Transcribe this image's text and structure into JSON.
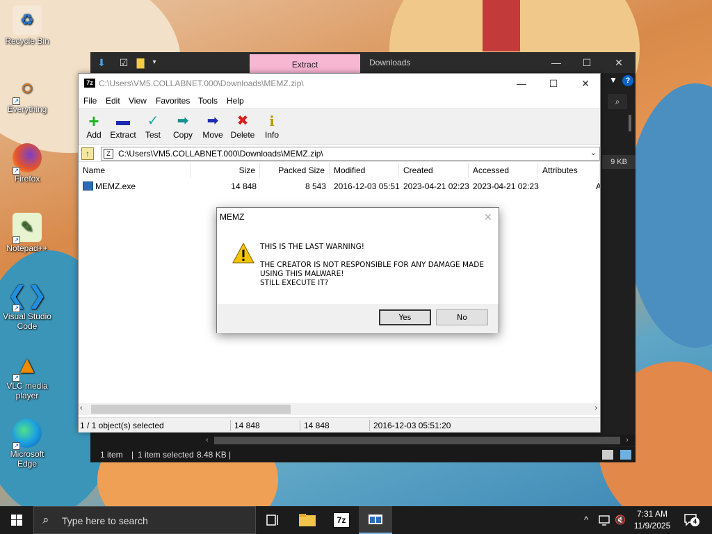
{
  "desktop": {
    "icons": [
      {
        "label": "Recycle Bin"
      },
      {
        "label": "Everything"
      },
      {
        "label": "Firefox"
      },
      {
        "label": "Notepad++"
      },
      {
        "label": "Visual Studio Code"
      },
      {
        "label": "VLC media player"
      },
      {
        "label": "Microsoft Edge"
      }
    ]
  },
  "explorer": {
    "tab_extract": "Extract",
    "tab_downloads": "Downloads",
    "size_chip": "9 KB",
    "status": {
      "items": "1 item",
      "selected": "1 item selected",
      "size": "8.48 KB",
      "sep": "|"
    }
  },
  "sevenzip": {
    "title": "C:\\Users\\VM5.COLLABNET.000\\Downloads\\MEMZ.zip\\",
    "menu": [
      "File",
      "Edit",
      "View",
      "Favorites",
      "Tools",
      "Help"
    ],
    "toolbar": [
      {
        "label": "Add",
        "icon": "+"
      },
      {
        "label": "Extract",
        "icon": "▬"
      },
      {
        "label": "Test",
        "icon": "✓"
      },
      {
        "label": "Copy",
        "icon": "➡"
      },
      {
        "label": "Move",
        "icon": "➡"
      },
      {
        "label": "Delete",
        "icon": "✖"
      },
      {
        "label": "Info",
        "icon": "i"
      }
    ],
    "address": "C:\\Users\\VM5.COLLABNET.000\\Downloads\\MEMZ.zip\\",
    "columns": [
      "Name",
      "Size",
      "Packed Size",
      "Modified",
      "Created",
      "Accessed",
      "Attributes"
    ],
    "rows": [
      {
        "name": "MEMZ.exe",
        "size": "14 848",
        "packed": "8 543",
        "modified": "2016-12-03 05:51",
        "created": "2023-04-21 02:23",
        "accessed": "2023-04-21 02:23",
        "attr": "A"
      }
    ],
    "status": {
      "selected": "1 / 1 object(s) selected",
      "size": "14 848",
      "packed": "14 848",
      "modified": "2016-12-03 05:51:20"
    }
  },
  "dialog": {
    "title": "MEMZ",
    "line1": "THIS IS THE LAST WARNING!",
    "line2": "THE CREATOR IS NOT RESPONSIBLE FOR ANY DAMAGE MADE",
    "line3": "USING THIS MALWARE!",
    "line4": "STILL EXECUTE IT?",
    "yes": "Yes",
    "no": "No"
  },
  "taskbar": {
    "search_placeholder": "Type here to search",
    "time": "7:31 AM",
    "date": "11/9/2025",
    "notification_count": "4",
    "sevenzip_label": "7z"
  },
  "colors": {
    "explorer_tab_accent": "#f7b6d2",
    "taskbar": "#1c1c1c",
    "accent": "#76b9ed"
  }
}
